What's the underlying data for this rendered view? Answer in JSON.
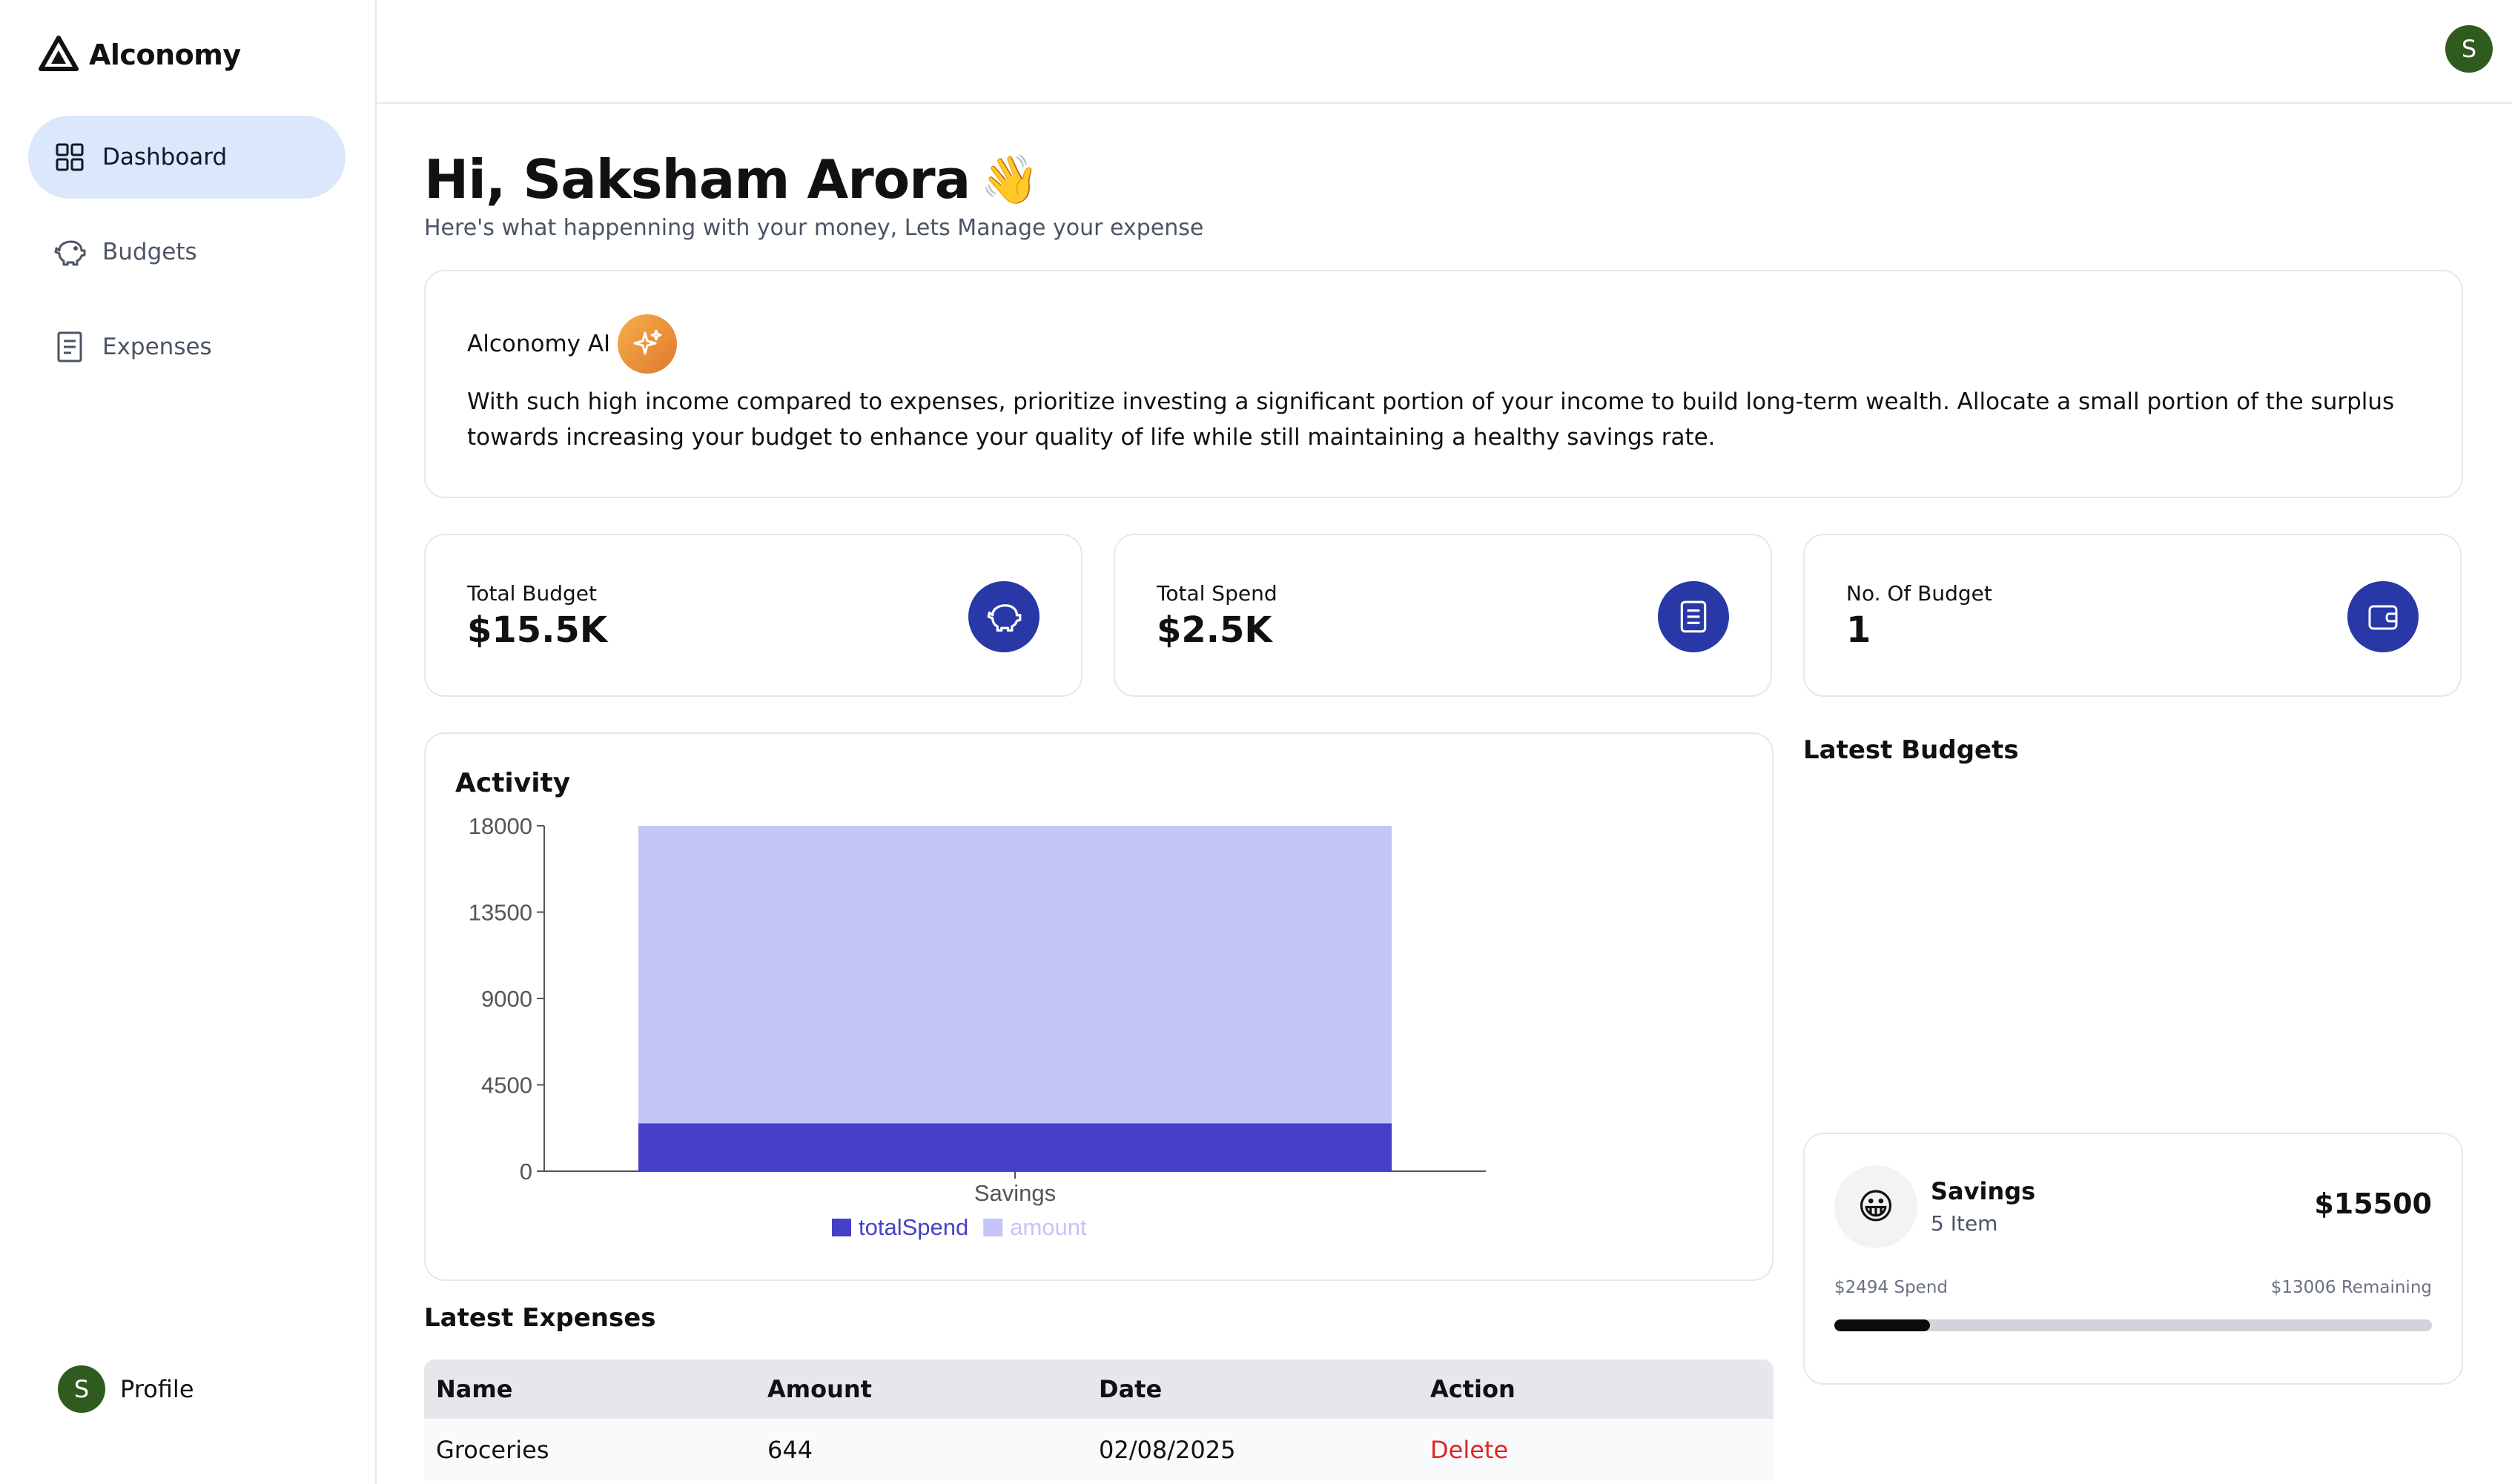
{
  "app": {
    "name": "Alconomy"
  },
  "sidebar": {
    "items": [
      {
        "label": "Dashboard",
        "icon": "grid-icon",
        "active": true
      },
      {
        "label": "Budgets",
        "icon": "piggy-bank-icon",
        "active": false
      },
      {
        "label": "Expenses",
        "icon": "receipt-icon",
        "active": false
      }
    ],
    "profile": {
      "initial": "S",
      "label": "Profile"
    }
  },
  "header": {
    "avatar_initial": "S"
  },
  "greeting": {
    "title": "Hi, Saksham Arora",
    "emoji": "👋",
    "subtitle": "Here's what happenning with your money, Lets Manage your expense"
  },
  "ai": {
    "title": "Alconomy AI",
    "message": "With such high income compared to expenses, prioritize investing a significant portion of your income to build long-term wealth. Allocate a small portion of the surplus towards increasing your budget to enhance your quality of life while still maintaining a healthy savings rate."
  },
  "stats": [
    {
      "label": "Total Budget",
      "value": "$15.5K",
      "icon": "piggy-bank-icon"
    },
    {
      "label": "Total Spend",
      "value": "$2.5K",
      "icon": "receipt-icon"
    },
    {
      "label": "No. Of Budget",
      "value": "1",
      "icon": "wallet-icon"
    }
  ],
  "activity": {
    "title": "Activity"
  },
  "chart_data": {
    "type": "bar",
    "stacked": true,
    "categories": [
      "Savings"
    ],
    "series": [
      {
        "name": "totalSpend",
        "values": [
          2494
        ],
        "color": "#4640c8"
      },
      {
        "name": "amount",
        "values": [
          15500
        ],
        "color": "#c4c4f8"
      }
    ],
    "yticks": [
      "18000",
      "13500",
      "9000",
      "4500",
      "0"
    ],
    "ylim": [
      0,
      18000
    ],
    "legend": "bottom"
  },
  "latest_budgets": {
    "title": "Latest Budgets",
    "items": [
      {
        "emoji": "😀",
        "name": "Savings",
        "items": "5 Item",
        "amount": "$15500",
        "spend": "$2494 Spend",
        "remaining": "$13006 Remaining",
        "progress": 0.16
      }
    ]
  },
  "latest_expenses": {
    "title": "Latest Expenses",
    "columns": [
      "Name",
      "Amount",
      "Date",
      "Action"
    ],
    "rows": [
      {
        "name": "Groceries",
        "amount": "644",
        "date": "02/08/2025",
        "action": "Delete"
      }
    ]
  },
  "colors": {
    "accent": "#2838a6",
    "active_nav": "#dbe7fb",
    "delete": "#dc2626"
  }
}
